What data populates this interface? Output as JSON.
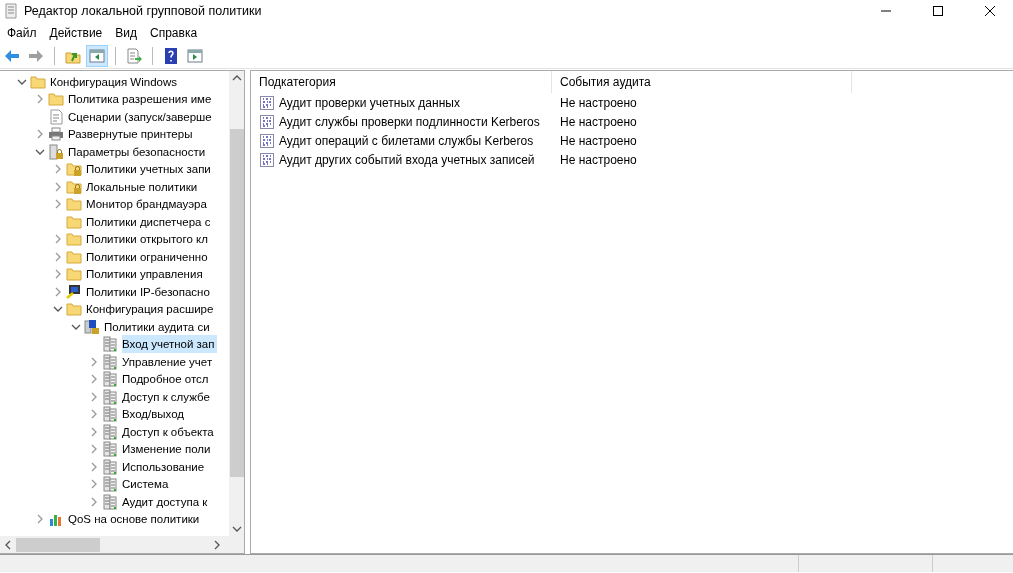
{
  "window": {
    "title": "Редактор локальной групповой политики"
  },
  "menu": [
    "Файл",
    "Действие",
    "Вид",
    "Справка"
  ],
  "toolbar": [
    {
      "kind": "back",
      "pressed": false,
      "disabled": false
    },
    {
      "kind": "forward",
      "pressed": false,
      "disabled": true
    },
    {
      "kind": "sep"
    },
    {
      "kind": "up",
      "pressed": false,
      "disabled": false
    },
    {
      "kind": "tree",
      "pressed": true,
      "disabled": false
    },
    {
      "kind": "sep"
    },
    {
      "kind": "export",
      "pressed": false,
      "disabled": false
    },
    {
      "kind": "sep"
    },
    {
      "kind": "help",
      "pressed": false,
      "disabled": false
    },
    {
      "kind": "pane",
      "pressed": false,
      "disabled": false
    }
  ],
  "tree": [
    {
      "label": "Конфигурация Windows",
      "kind": "folder",
      "expanded": true,
      "selected": false,
      "children": [
        {
          "label": "Политика разрешения име",
          "kind": "folder",
          "expanded": false,
          "selected": false
        },
        {
          "label": "Сценарии (запуск/заверше",
          "kind": "script",
          "selected": false
        },
        {
          "label": "Развернутые принтеры",
          "kind": "printer",
          "expanded": false,
          "selected": false
        },
        {
          "label": "Параметры безопасности",
          "kind": "security",
          "expanded": true,
          "selected": false,
          "children": [
            {
              "label": "Политики учетных запи",
              "kind": "lockfolder",
              "expanded": false,
              "selected": false
            },
            {
              "label": "Локальные политики",
              "kind": "lockfolder",
              "expanded": false,
              "selected": false
            },
            {
              "label": "Монитор брандмауэра",
              "kind": "folder",
              "expanded": false,
              "selected": false
            },
            {
              "label": "Политики диспетчера с",
              "kind": "folder",
              "selected": false
            },
            {
              "label": "Политики открытого кл",
              "kind": "folder",
              "expanded": false,
              "selected": false
            },
            {
              "label": "Политики ограниченно",
              "kind": "folder",
              "expanded": false,
              "selected": false
            },
            {
              "label": "Политики управления",
              "kind": "folder",
              "expanded": false,
              "selected": false
            },
            {
              "label": "Политики IP-безопасно",
              "kind": "ip",
              "expanded": false,
              "selected": false
            },
            {
              "label": "Конфигурация расшире",
              "kind": "folder",
              "expanded": true,
              "selected": false,
              "children": [
                {
                  "label": "Политики аудита си",
                  "kind": "auditroot",
                  "expanded": true,
                  "selected": false,
                  "children": [
                    {
                      "label": "Вход учетной зап",
                      "kind": "audit",
                      "selected": true
                    },
                    {
                      "label": "Управление учет",
                      "kind": "audit",
                      "expanded": false,
                      "selected": false
                    },
                    {
                      "label": "Подробное отсл",
                      "kind": "audit",
                      "expanded": false,
                      "selected": false
                    },
                    {
                      "label": "Доступ к службе",
                      "kind": "audit",
                      "expanded": false,
                      "selected": false
                    },
                    {
                      "label": "Вход/выход",
                      "kind": "audit",
                      "expanded": false,
                      "selected": false
                    },
                    {
                      "label": "Доступ к объекта",
                      "kind": "audit",
                      "expanded": false,
                      "selected": false
                    },
                    {
                      "label": "Изменение поли",
                      "kind": "audit",
                      "expanded": false,
                      "selected": false
                    },
                    {
                      "label": "Использование",
                      "kind": "audit",
                      "expanded": false,
                      "selected": false
                    },
                    {
                      "label": "Система",
                      "kind": "audit",
                      "expanded": false,
                      "selected": false
                    },
                    {
                      "label": "Аудит доступа к",
                      "kind": "audit",
                      "expanded": false,
                      "selected": false
                    }
                  ]
                }
              ]
            }
          ]
        },
        {
          "label": "QoS на основе политики",
          "kind": "chart",
          "expanded": false,
          "selected": false
        }
      ]
    }
  ],
  "table": {
    "columns": [
      "Подкатегория",
      "События аудита"
    ],
    "rows": [
      {
        "name": "Аудит проверки учетных данных",
        "value": "Не настроено"
      },
      {
        "name": "Аудит службы проверки подлинности Kerberos",
        "value": "Не настроено"
      },
      {
        "name": "Аудит операций с билетами службы Kerberos",
        "value": "Не настроено"
      },
      {
        "name": "Аудит других событий входа учетных записей",
        "value": "Не настроено"
      }
    ]
  }
}
